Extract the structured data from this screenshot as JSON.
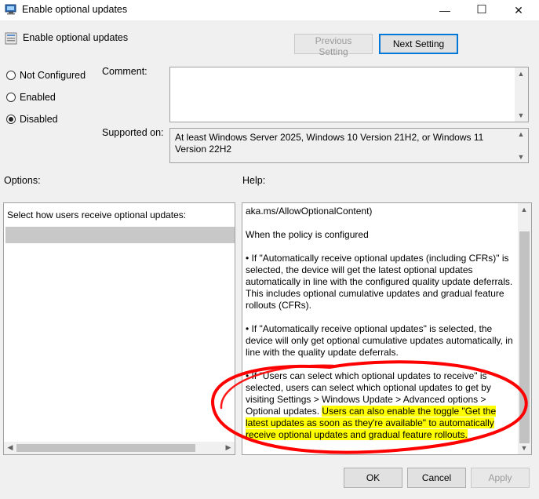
{
  "window": {
    "title": "Enable optional updates",
    "minimize_glyph": "—",
    "maximize_glyph": "☐",
    "close_glyph": "✕"
  },
  "header": {
    "policy_title": "Enable optional updates",
    "previous_button": "Previous Setting",
    "next_button": "Next Setting"
  },
  "state": {
    "options": [
      {
        "label": "Not Configured",
        "checked": false
      },
      {
        "label": "Enabled",
        "checked": false
      },
      {
        "label": "Disabled",
        "checked": true
      }
    ]
  },
  "comment": {
    "label": "Comment:",
    "value": ""
  },
  "supported": {
    "label": "Supported on:",
    "value": "At least Windows Server 2025, Windows 10 Version 21H2, or Windows 11 Version 22H2"
  },
  "options_panel": {
    "label": "Options:",
    "prompt": "Select how users receive optional updates:"
  },
  "help_panel": {
    "label": "Help:",
    "line1": "aka.ms/AllowOptionalContent)",
    "p1": "When the policy is configured",
    "p2": "• If \"Automatically receive optional updates (including CFRs)\" is selected, the device will get the latest optional updates automatically in line with the configured quality update deferrals. This includes optional cumulative updates and gradual feature rollouts (CFRs).",
    "p3": "• If \"Automatically receive optional updates\" is selected, the device will only get optional cumulative updates automatically, in line with the quality update deferrals.",
    "p4_plain": "• If \"Users can select which optional updates to receive\" is selected, users can select which optional updates to get by visiting Settings > Windows Update > Advanced options > Optional updates.",
    "p4_highlight": "Users can also enable the toggle \"Get the latest updates as soon as they're available\" to automatically receive optional updates and gradual feature rollouts."
  },
  "footer": {
    "ok": "OK",
    "cancel": "Cancel",
    "apply": "Apply"
  },
  "colors": {
    "highlight": "#ffff00",
    "annotation": "#ff0000",
    "accent": "#0078d7"
  },
  "icons": {
    "window": "policy-icon",
    "header": "settings-page-icon"
  }
}
